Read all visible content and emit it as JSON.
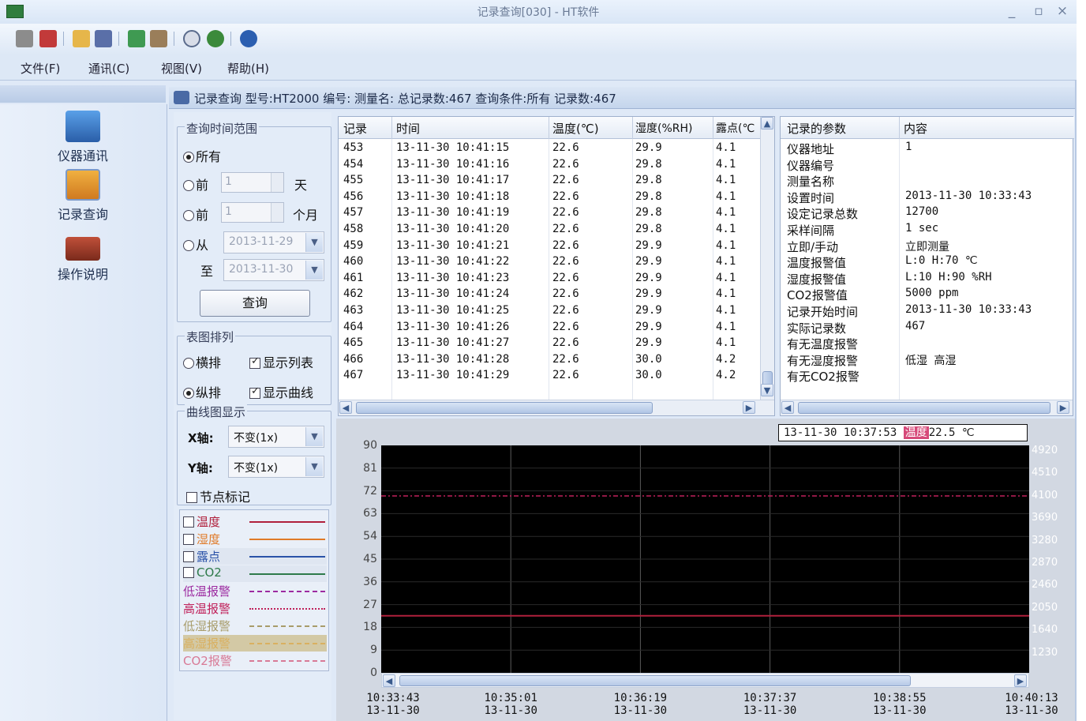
{
  "window": {
    "title": "记录查询[030] - HT软件",
    "minimize": "_",
    "maximize": "▫",
    "close": "×"
  },
  "menu": [
    "文件(F)",
    "通讯(C)",
    "视图(V)",
    "帮助(H)"
  ],
  "toolbar_icons": [
    "grid-icon",
    "tools-icon",
    "open-folder-icon",
    "save-icon",
    "export-icon",
    "print-icon",
    "clock-icon",
    "refresh-icon",
    "help-icon"
  ],
  "nav": [
    {
      "label": "仪器通讯",
      "icon": "monitor-icon"
    },
    {
      "label": "记录查询",
      "icon": "record-query-icon"
    },
    {
      "label": "操作说明",
      "icon": "book-icon"
    }
  ],
  "status": {
    "text": "记录查询  型号:HT2000 编号: 测量名:  总记录数:467  查询条件:所有 记录数:467"
  },
  "query": {
    "range_label": "查询时间范围",
    "opt_all": "所有",
    "opt_days_prefix": "前",
    "days_value": "1",
    "days_unit": "天",
    "opt_months_prefix": "前",
    "months_value": "1",
    "months_unit": "个月",
    "opt_from": "从",
    "from_date": "2013-11-29",
    "to_label": "至",
    "to_date": "2013-11-30",
    "button": "查询",
    "layout_label": "表图排列",
    "horizontal": "横排",
    "vertical": "纵排",
    "show_list": "显示列表",
    "show_curve": "显示曲线",
    "curve_label": "曲线图显示",
    "x_axis_label": "X轴:",
    "x_axis_value": "不变(1x)",
    "y_axis_label": "Y轴:",
    "y_axis_value": "不变(1x)",
    "node_mark": "节点标记"
  },
  "legend": [
    {
      "label": "温度",
      "checked": true,
      "color": "#b0203c",
      "style": "solid"
    },
    {
      "label": "湿度",
      "checked": false,
      "color": "#e07a28",
      "style": "solid"
    },
    {
      "label": "露点",
      "checked": false,
      "color": "#2a52a8",
      "style": "solid"
    },
    {
      "label": "CO2",
      "checked": false,
      "color": "#2e7a4a",
      "style": "solid"
    },
    {
      "label": "低温报警",
      "checked": null,
      "color": "#9c2aa0",
      "style": "dashed"
    },
    {
      "label": "高温报警",
      "checked": null,
      "color": "#c0205a",
      "style": "dashdot"
    },
    {
      "label": "低湿报警",
      "checked": null,
      "color": "#a89c6a",
      "style": "dashed"
    },
    {
      "label": "高湿报警",
      "checked": null,
      "color": "#d9b060",
      "style": "dashed"
    },
    {
      "label": "CO2报警",
      "checked": null,
      "color": "#d87a96",
      "style": "dashed"
    }
  ],
  "table": {
    "headers": [
      "记录",
      "时间",
      "温度(℃)",
      "湿度(%RH)",
      "露点(℃"
    ],
    "rows": [
      [
        "453",
        "13-11-30  10:41:15",
        "22.6",
        "29.9",
        "4.1"
      ],
      [
        "454",
        "13-11-30  10:41:16",
        "22.6",
        "29.8",
        "4.1"
      ],
      [
        "455",
        "13-11-30  10:41:17",
        "22.6",
        "29.8",
        "4.1"
      ],
      [
        "456",
        "13-11-30  10:41:18",
        "22.6",
        "29.8",
        "4.1"
      ],
      [
        "457",
        "13-11-30  10:41:19",
        "22.6",
        "29.8",
        "4.1"
      ],
      [
        "458",
        "13-11-30  10:41:20",
        "22.6",
        "29.8",
        "4.1"
      ],
      [
        "459",
        "13-11-30  10:41:21",
        "22.6",
        "29.9",
        "4.1"
      ],
      [
        "460",
        "13-11-30  10:41:22",
        "22.6",
        "29.9",
        "4.1"
      ],
      [
        "461",
        "13-11-30  10:41:23",
        "22.6",
        "29.9",
        "4.1"
      ],
      [
        "462",
        "13-11-30  10:41:24",
        "22.6",
        "29.9",
        "4.1"
      ],
      [
        "463",
        "13-11-30  10:41:25",
        "22.6",
        "29.9",
        "4.1"
      ],
      [
        "464",
        "13-11-30  10:41:26",
        "22.6",
        "29.9",
        "4.1"
      ],
      [
        "465",
        "13-11-30  10:41:27",
        "22.6",
        "29.9",
        "4.1"
      ],
      [
        "466",
        "13-11-30  10:41:28",
        "22.6",
        "30.0",
        "4.2"
      ],
      [
        "467",
        "13-11-30  10:41:29",
        "22.6",
        "30.0",
        "4.2"
      ]
    ]
  },
  "params": {
    "headers": [
      "记录的参数",
      "内容"
    ],
    "rows": [
      [
        "仪器地址",
        "1"
      ],
      [
        "仪器编号",
        ""
      ],
      [
        "测量名称",
        ""
      ],
      [
        "设置时间",
        "2013-11-30 10:33:43"
      ],
      [
        "设定记录总数",
        "12700"
      ],
      [
        "采样间隔",
        "1 sec"
      ],
      [
        "立即/手动",
        "立即测量"
      ],
      [
        "温度报警值",
        "L:0 H:70 ℃"
      ],
      [
        "湿度报警值",
        "L:10 H:90 %RH"
      ],
      [
        "CO2报警值",
        "5000 ppm"
      ],
      [
        "记录开始时间",
        "2013-11-30 10:33:43"
      ],
      [
        "实际记录数",
        "467"
      ],
      [
        "有无温度报警",
        ""
      ],
      [
        "有无湿度报警",
        "低湿 高湿"
      ],
      [
        "有无CO2报警",
        ""
      ]
    ]
  },
  "chart": {
    "readout_time": "13-11-30 10:37:53",
    "readout_tag": "温度",
    "readout_value": "22.5 ℃",
    "colors": {
      "background": "#000000",
      "grid": "#5a5a5a",
      "temperature": "#b0203c",
      "high_alarm": "#c0205a"
    }
  },
  "chart_data": {
    "type": "line",
    "y_left_ticks": [
      "90",
      "81",
      "72",
      "63",
      "54",
      "45",
      "36",
      "27",
      "18",
      "9",
      "0"
    ],
    "y_right_ticks": [
      "4920",
      "4510",
      "4100",
      "3690",
      "3280",
      "2870",
      "2460",
      "2050",
      "1640",
      "1230"
    ],
    "x_ticks": [
      {
        "time": "10:33:43",
        "date": "13-11-30"
      },
      {
        "time": "10:35:01",
        "date": "13-11-30"
      },
      {
        "time": "10:36:19",
        "date": "13-11-30"
      },
      {
        "time": "10:37:37",
        "date": "13-11-30"
      },
      {
        "time": "10:38:55",
        "date": "13-11-30"
      },
      {
        "time": "10:40:13",
        "date": "13-11-30"
      }
    ],
    "ylim": [
      0,
      90
    ],
    "series": [
      {
        "name": "温度",
        "values": [
          22.6,
          22.6,
          22.6,
          22.6,
          22.6,
          22.6
        ],
        "style": "solid",
        "color": "#b0203c"
      },
      {
        "name": "高温报警",
        "values": [
          70,
          70,
          70,
          70,
          70,
          70
        ],
        "style": "dashdot",
        "color": "#c0205a"
      }
    ],
    "grid": true
  }
}
